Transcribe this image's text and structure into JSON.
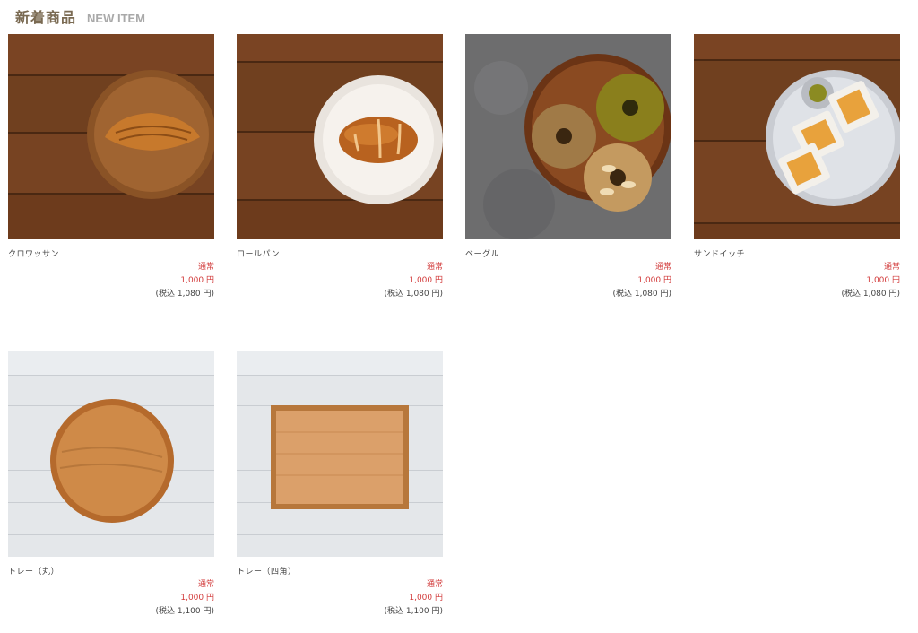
{
  "section": {
    "title": "新着商品",
    "subtitle": "NEW ITEM"
  },
  "colors": {
    "price": "#d23b3b",
    "heading": "#7a6a52"
  },
  "products": [
    {
      "name": "クロワッサン",
      "label": "通常",
      "price": "1,000 円",
      "tax": "(税込 1,080 円)",
      "image": "croissant-on-wooden-plate"
    },
    {
      "name": "ロールパン",
      "label": "通常",
      "price": "1,000 円",
      "tax": "(税込 1,080 円)",
      "image": "roll-bread-on-white-plate"
    },
    {
      "name": "ベーグル",
      "label": "通常",
      "price": "1,000 円",
      "tax": "(税込 1,080 円)",
      "image": "bagels-on-wooden-plate"
    },
    {
      "name": "サンドイッチ",
      "label": "通常",
      "price": "1,000 円",
      "tax": "(税込 1,080 円)",
      "image": "egg-sandwich-on-plate"
    },
    {
      "name": "トレー（丸）",
      "label": "通常",
      "price": "1,000 円",
      "tax": "(税込 1,100 円)",
      "image": "round-wooden-tray"
    },
    {
      "name": "トレー（四角）",
      "label": "通常",
      "price": "1,000 円",
      "tax": "(税込 1,100 円)",
      "image": "square-wooden-tray"
    }
  ]
}
